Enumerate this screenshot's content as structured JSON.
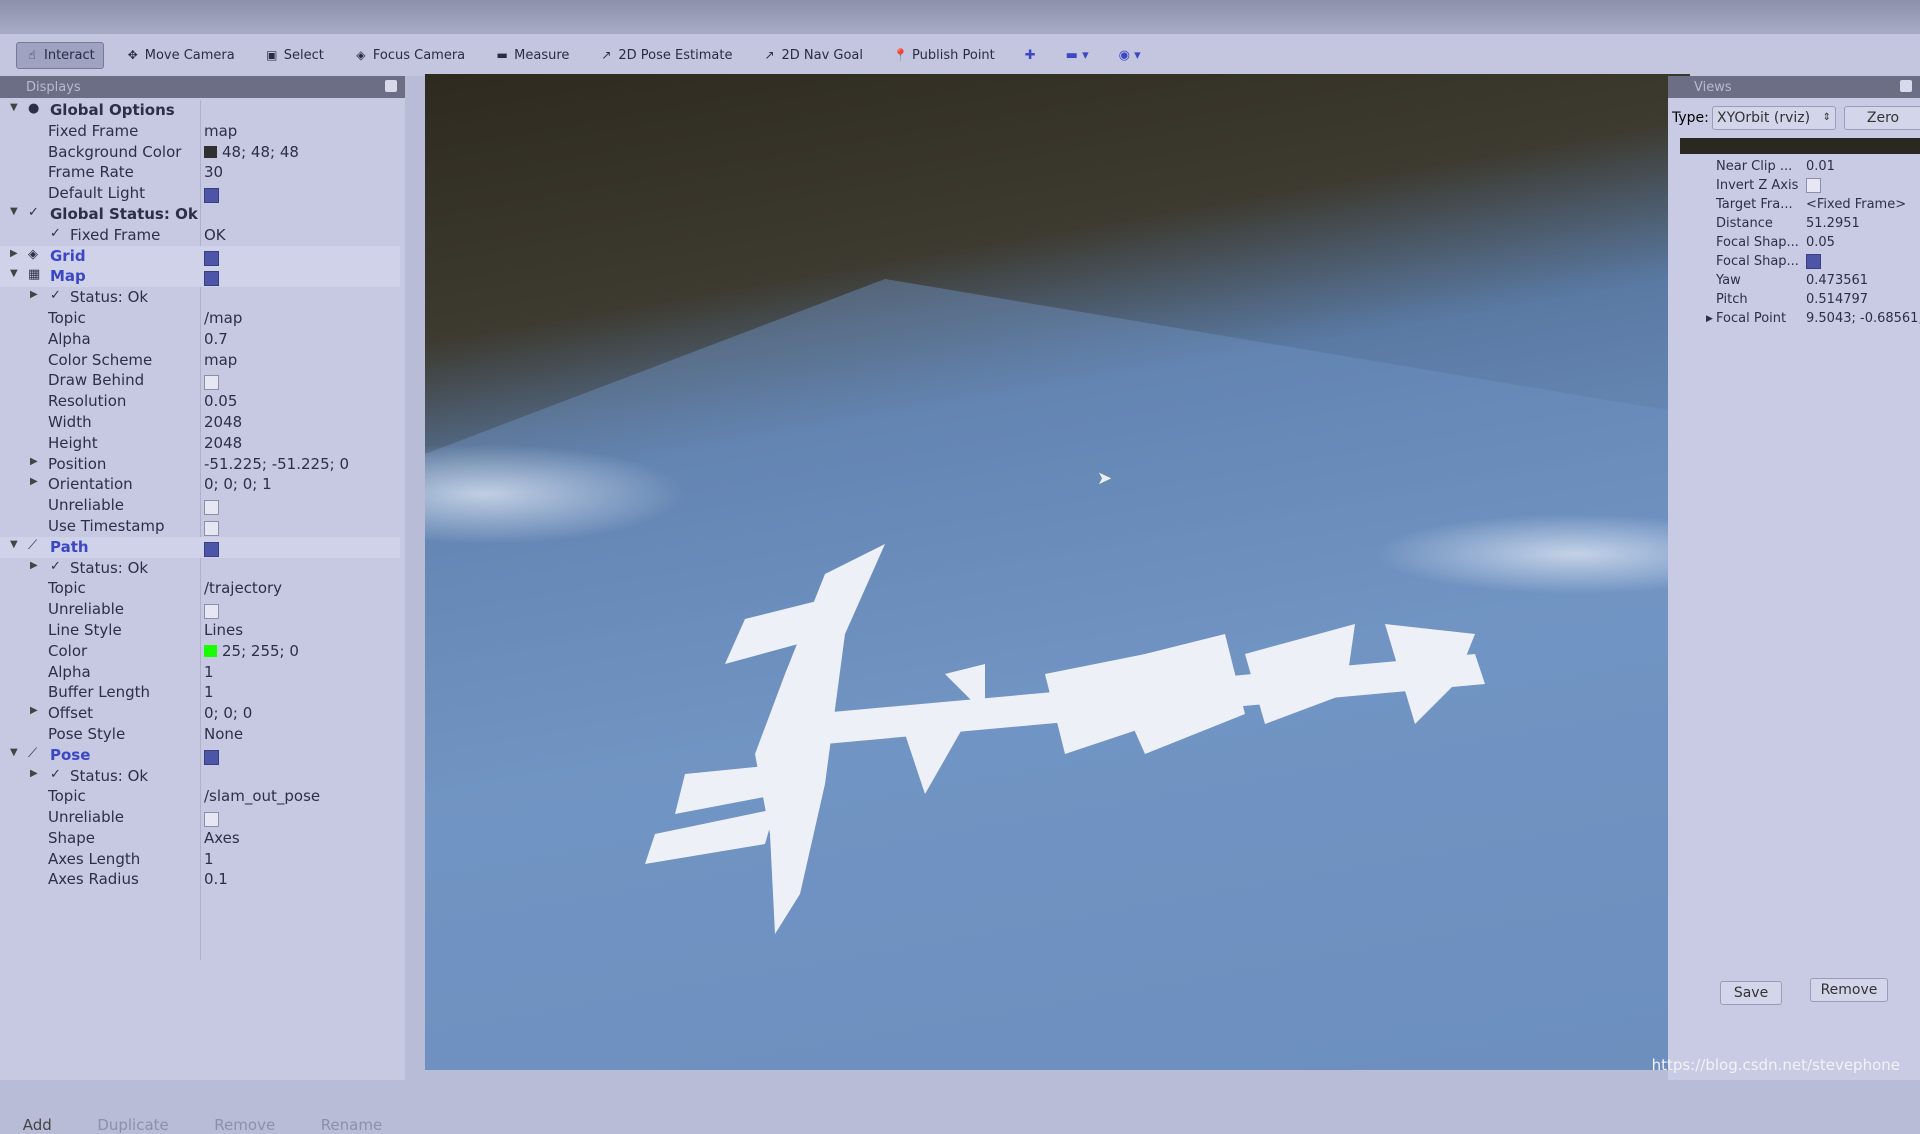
{
  "toolbar": {
    "items": [
      {
        "label": "Interact",
        "icon": "hand-icon",
        "active": true
      },
      {
        "label": "Move Camera",
        "icon": "move-icon"
      },
      {
        "label": "Select",
        "icon": "select-icon"
      },
      {
        "label": "Focus Camera",
        "icon": "focus-icon"
      },
      {
        "label": "Measure",
        "icon": "ruler-icon"
      },
      {
        "label": "2D Pose Estimate",
        "icon": "arrow-icon"
      },
      {
        "label": "2D Nav Goal",
        "icon": "arrow-icon"
      },
      {
        "label": "Publish Point",
        "icon": "pin-icon"
      }
    ]
  },
  "displays": {
    "title": "Displays",
    "rows": [
      {
        "l": 0,
        "e": "▼",
        "ico": "●",
        "label": "Global Options",
        "cls": "bold"
      },
      {
        "l": 1,
        "label": "Fixed Frame",
        "val": "map"
      },
      {
        "l": 1,
        "label": "Background Color",
        "val": "48; 48; 48",
        "color": "#303030"
      },
      {
        "l": 1,
        "label": "Frame Rate",
        "val": "30"
      },
      {
        "l": 1,
        "label": "Default Light",
        "cb": true
      },
      {
        "l": 0,
        "e": "▼",
        "ico": "✓",
        "label": "Global Status: Ok",
        "cls": "bold"
      },
      {
        "l": 1,
        "ico": "✓",
        "label": "Fixed Frame",
        "val": "OK"
      },
      {
        "l": 0,
        "e": "▶",
        "ico": "◈",
        "label": "Grid",
        "cls": "blue",
        "cb": true,
        "hl": true
      },
      {
        "l": 0,
        "e": "▼",
        "ico": "▦",
        "label": "Map",
        "cls": "blue",
        "cb": true,
        "hl": true
      },
      {
        "l": 1,
        "e": "▶",
        "ico": "✓",
        "label": "Status: Ok"
      },
      {
        "l": 1,
        "label": "Topic",
        "val": "/map"
      },
      {
        "l": 1,
        "label": "Alpha",
        "val": "0.7"
      },
      {
        "l": 1,
        "label": "Color Scheme",
        "val": "map"
      },
      {
        "l": 1,
        "label": "Draw Behind",
        "cb": false
      },
      {
        "l": 1,
        "label": "Resolution",
        "val": "0.05"
      },
      {
        "l": 1,
        "label": "Width",
        "val": "2048"
      },
      {
        "l": 1,
        "label": "Height",
        "val": "2048"
      },
      {
        "l": 1,
        "e": "▶",
        "label": "Position",
        "val": "-51.225; -51.225; 0"
      },
      {
        "l": 1,
        "e": "▶",
        "label": "Orientation",
        "val": "0; 0; 0; 1"
      },
      {
        "l": 1,
        "label": "Unreliable",
        "cb": false
      },
      {
        "l": 1,
        "label": "Use Timestamp",
        "cb": false
      },
      {
        "l": 0,
        "e": "▼",
        "ico": "⟋",
        "label": "Path",
        "cls": "blue",
        "cb": true,
        "hl": true
      },
      {
        "l": 1,
        "e": "▶",
        "ico": "✓",
        "label": "Status: Ok"
      },
      {
        "l": 1,
        "label": "Topic",
        "val": "/trajectory"
      },
      {
        "l": 1,
        "label": "Unreliable",
        "cb": false
      },
      {
        "l": 1,
        "label": "Line Style",
        "val": "Lines"
      },
      {
        "l": 1,
        "label": "Color",
        "val": "25; 255; 0",
        "color": "#19ff00"
      },
      {
        "l": 1,
        "label": "Alpha",
        "val": "1"
      },
      {
        "l": 1,
        "label": "Buffer Length",
        "val": "1"
      },
      {
        "l": 1,
        "e": "▶",
        "label": "Offset",
        "val": "0; 0; 0"
      },
      {
        "l": 1,
        "label": "Pose Style",
        "val": "None"
      },
      {
        "l": 0,
        "e": "▼",
        "ico": "⟋",
        "label": "Pose",
        "cls": "blue",
        "cb": true
      },
      {
        "l": 1,
        "e": "▶",
        "ico": "✓",
        "label": "Status: Ok"
      },
      {
        "l": 1,
        "label": "Topic",
        "val": "/slam_out_pose"
      },
      {
        "l": 1,
        "label": "Unreliable",
        "cb": false
      },
      {
        "l": 1,
        "label": "Shape",
        "val": "Axes"
      },
      {
        "l": 1,
        "label": "Axes Length",
        "val": "1"
      },
      {
        "l": 1,
        "label": "Axes Radius",
        "val": "0.1"
      }
    ],
    "buttons": [
      "Add",
      "Duplicate",
      "Remove",
      "Rename"
    ]
  },
  "views": {
    "title": "Views",
    "type_label": "Type:",
    "type_value": "XYOrbit (rviz)",
    "zero": "Zero",
    "props": [
      {
        "k": "Near Clip ...",
        "v": "0.01"
      },
      {
        "k": "Invert Z Axis",
        "cb": false
      },
      {
        "k": "Target Fra...",
        "v": "<Fixed Frame>"
      },
      {
        "k": "Distance",
        "v": "51.2951"
      },
      {
        "k": "Focal Shap...",
        "v": "0.05"
      },
      {
        "k": "Focal Shap...",
        "cb": true
      },
      {
        "k": "Yaw",
        "v": "0.473561"
      },
      {
        "k": "Pitch",
        "v": "0.514797"
      },
      {
        "k": "Focal Point",
        "v": "9.5043; -0.68561;",
        "e": true
      }
    ],
    "save": "Save",
    "remove": "Remove"
  },
  "watermark": "https://blog.csdn.net/stevephone"
}
